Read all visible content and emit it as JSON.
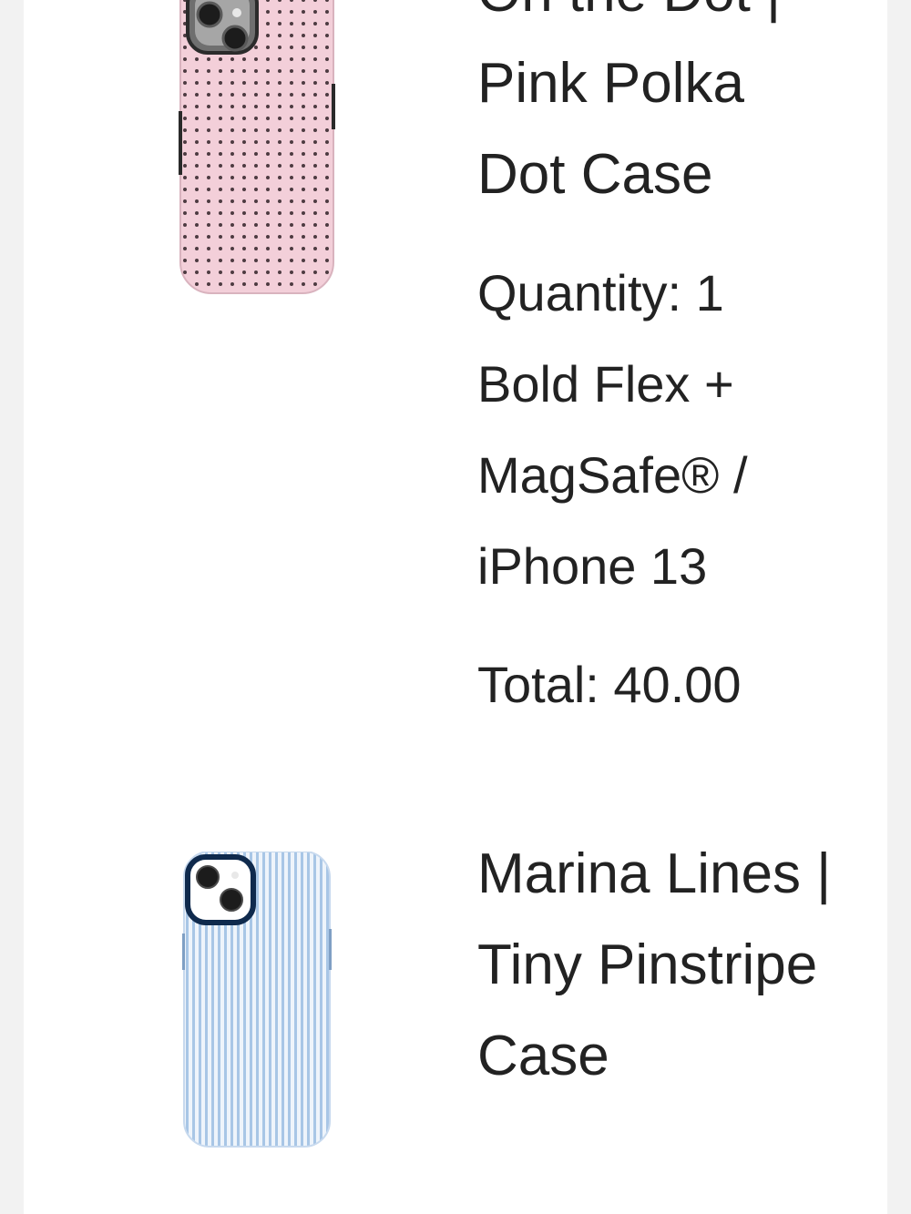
{
  "order_items": [
    {
      "title": "On the Dot | Pink Polka Dot Case",
      "quantity": "Quantity: 1",
      "variant": "Bold Flex + MagSafe® / iPhone 13",
      "total": "Total: 40.00",
      "image_colors": {
        "case": "#f3cfd9",
        "dots": "#3a2a30",
        "camera": "#9a9a9a"
      }
    },
    {
      "title": "Marina Lines | Tiny Pinstripe Case",
      "image_colors": {
        "case": "#eef4fb",
        "stripes": "#a8c6e6",
        "camera": "#0f2a4d"
      }
    }
  ]
}
